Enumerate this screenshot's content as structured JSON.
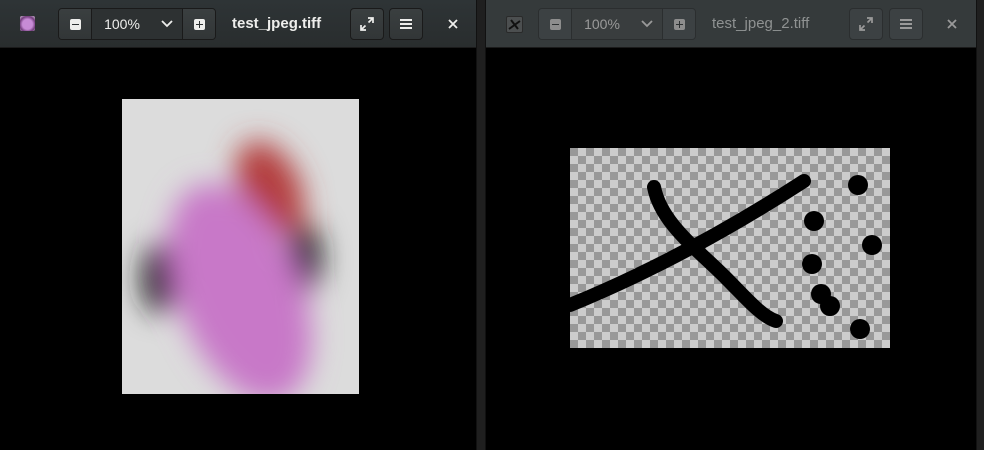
{
  "windows": [
    {
      "title": "test_jpeg.tiff",
      "zoom": "100%",
      "active": true,
      "image_description_icon": "image-thumbnail-icon"
    },
    {
      "title": "test_jpeg_2.tiff",
      "zoom": "100%",
      "active": false,
      "image_description_icon": "image-thumbnail-icon"
    }
  ],
  "colors": {
    "headerbar": "#2e3436",
    "content_bg": "#000000",
    "image1_bg": "#dcdcdc",
    "image1_blob": "#c878c8",
    "image1_accent": "#b43c3c",
    "checker_light": "#cccccc",
    "checker_dark": "#999999"
  },
  "icons": {
    "zoom_out": "minus-square-icon",
    "zoom_dropdown": "chevron-down-icon",
    "zoom_in": "plus-square-icon",
    "fullscreen": "expand-icon",
    "menu": "hamburger-menu-icon",
    "close": "close-icon"
  }
}
